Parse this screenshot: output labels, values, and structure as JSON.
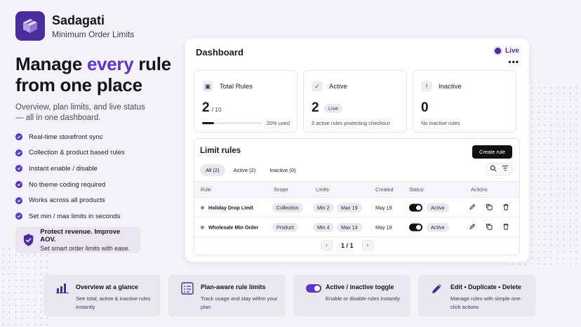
{
  "brand": {
    "name": "Sadagati",
    "subtitle": "Minimum Order Limits",
    "logo_icon": "box-stack-icon"
  },
  "hero": {
    "title_pre": "Manage ",
    "title_accent": "every",
    "title_post": " rule",
    "title_line2": "from one place",
    "subtitle": "Overview, plan limits, and live status — all in one dashboard."
  },
  "features": [
    "Real-time storefront sync",
    "Collection & product based rules",
    "Instant enable / disable",
    "No theme coding required",
    "Works across all products",
    "Set min / max limits in seconds"
  ],
  "promo": {
    "title": "Protect revenue. Improve AOV.",
    "subtitle": "Set smart order limits with ease.",
    "icon": "shield-check-icon"
  },
  "dashboard": {
    "title": "Dashboard",
    "status": "Live",
    "stats": {
      "total": {
        "label": "Total Rules",
        "value": "2",
        "of": "/ 10",
        "used": "20% used",
        "progress": 0.2
      },
      "active": {
        "label": "Active",
        "value": "2",
        "badge": "Live",
        "note": "2 active rules protecting checkout"
      },
      "inactive": {
        "label": "Inactive",
        "value": "0",
        "note": "No inactive rules"
      }
    },
    "rules": {
      "title": "Limit rules",
      "create_label": "Create rule",
      "tabs": [
        "All (2)",
        "Active (2)",
        "Inactive (0)"
      ],
      "columns": [
        "Rule",
        "Scope",
        "Limits",
        "Created",
        "Status",
        "Actions"
      ],
      "rows": [
        {
          "name": "Holiday Drop Limit",
          "scope": "Collection",
          "min": "Min 2",
          "max": "Max 19",
          "created": "May 18",
          "status": "Active"
        },
        {
          "name": "Wholesale Min Order",
          "scope": "Product",
          "min": "Min 4",
          "max": "Max 14",
          "created": "May 18",
          "status": "Active"
        }
      ],
      "pager": "1 / 1"
    }
  },
  "bottom_cards": [
    {
      "title": "Overview at a glance",
      "text": "See total, active & inactive rules instantly",
      "icon": "bar-chart-icon"
    },
    {
      "title": "Plan-aware rule limits",
      "text": "Track usage and stay within your plan",
      "icon": "list-check-icon"
    },
    {
      "title": "Active / inactive toggle",
      "text": "Enable or disable rules instantly",
      "icon": "toggle-icon"
    },
    {
      "title": "Edit • Duplicate • Delete",
      "text": "Manage rules with simple one-click actions",
      "icon": "pencil-icon"
    }
  ],
  "colors": {
    "accent": "#5b36c9",
    "brand": "#4a2c9a",
    "dark": "#111111"
  }
}
